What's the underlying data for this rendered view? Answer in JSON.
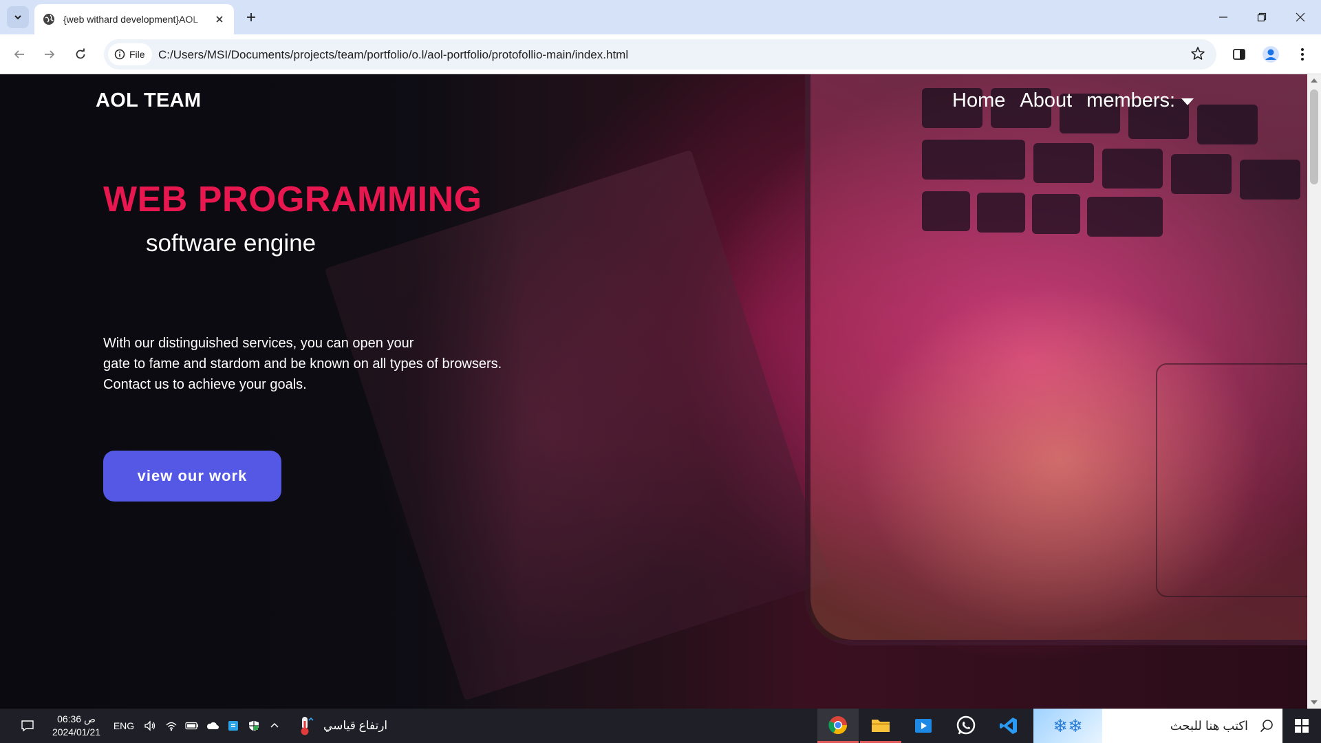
{
  "browser": {
    "tab_title": "{web withard development}AOL",
    "omnibox_chip": "File",
    "url": "C:/Users/MSI/Documents/projects/team/portfolio/o.l/aol-portfolio/protofollio-main/index.html"
  },
  "page": {
    "logo": "AOL TEAM",
    "nav": {
      "home": "Home",
      "about": "About",
      "members": "members:"
    },
    "headline": "WEB PROGRAMMING",
    "subheadline": "software engine",
    "description_lines": [
      "With our distinguished services, you can open your",
      "gate to fame and stardom and be known on all types of browsers.",
      "Contact us to achieve your goals."
    ],
    "cta_label": "view our work",
    "colors": {
      "headline": "#e8174f",
      "cta_background": "#5458e4"
    }
  },
  "taskbar": {
    "clock_time": "06:36 ص",
    "clock_date": "2024/01/21",
    "language": "ENG",
    "weather_text": "ارتفاع قياسي",
    "search_placeholder": "اكتب هنا للبحث"
  }
}
